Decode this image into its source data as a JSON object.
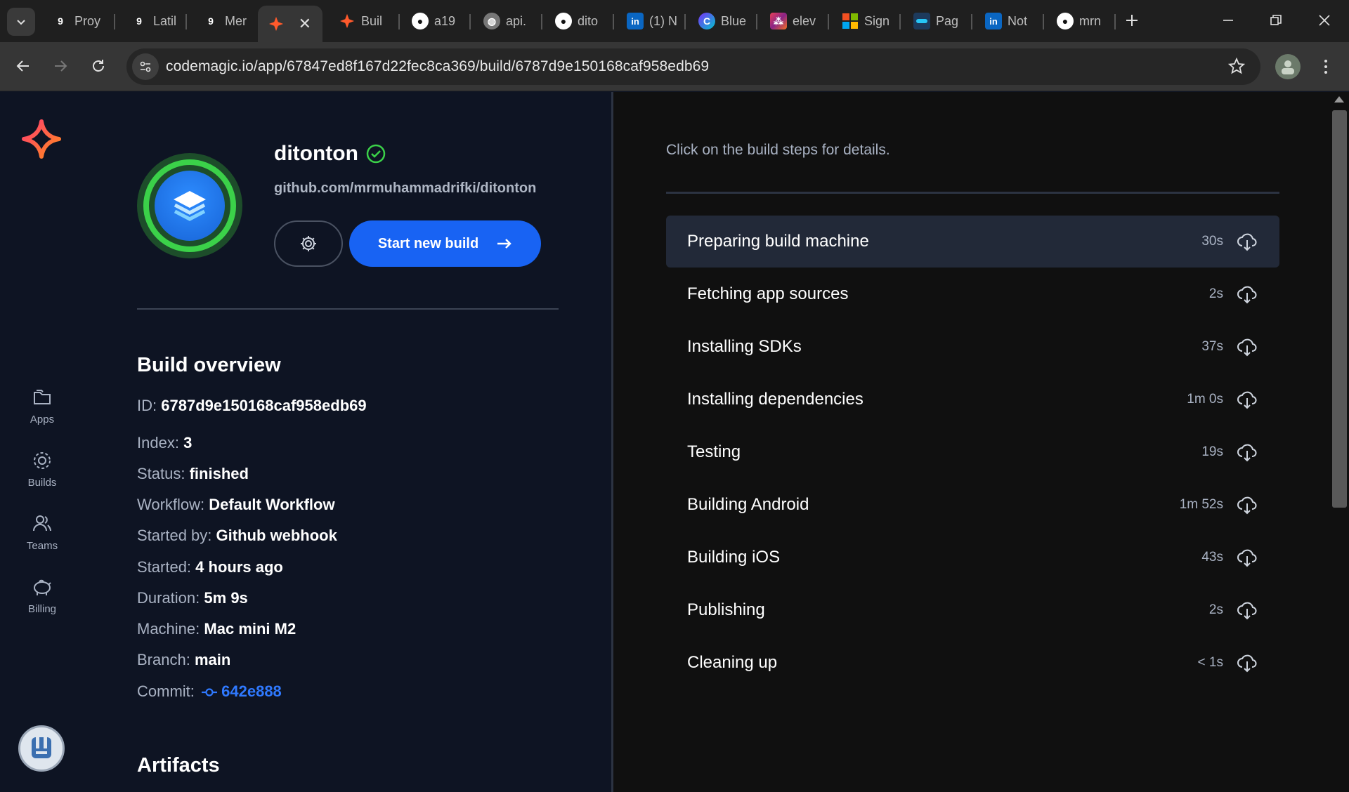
{
  "browser": {
    "tabs": [
      {
        "title": "Proy",
        "icon": "g9-icon"
      },
      {
        "title": "Latil",
        "icon": "g9-icon"
      },
      {
        "title": "Mer",
        "icon": "g9-icon"
      },
      {
        "title": "",
        "icon": "codemagic-icon"
      },
      {
        "title": "Buil",
        "icon": "codemagic-icon"
      },
      {
        "title": "a19",
        "icon": "github-icon"
      },
      {
        "title": "api.",
        "icon": "globe-icon"
      },
      {
        "title": "dito",
        "icon": "github-icon"
      },
      {
        "title": "(1) N",
        "icon": "linkedin-icon"
      },
      {
        "title": "Blue",
        "icon": "canva-icon"
      },
      {
        "title": "elev",
        "icon": "elevate-icon"
      },
      {
        "title": "Sign",
        "icon": "microsoft-icon"
      },
      {
        "title": "Pag",
        "icon": "page-icon"
      },
      {
        "title": "Not",
        "icon": "linkedin-icon"
      },
      {
        "title": "mrn",
        "icon": "github-icon"
      }
    ],
    "url": "codemagic.io/app/67847ed8f167d22fec8ca369/build/6787d9e150168caf958edb69"
  },
  "sidebar": {
    "items": [
      {
        "label": "Apps",
        "icon": "folder-icon"
      },
      {
        "label": "Builds",
        "icon": "builds-icon"
      },
      {
        "label": "Teams",
        "icon": "people-icon"
      },
      {
        "label": "Billing",
        "icon": "piggy-bank-icon"
      }
    ]
  },
  "app": {
    "name": "ditonton",
    "repo": "github.com/mrmuhammadrifki/ditonton",
    "start_build_label": "Start new build"
  },
  "overview": {
    "title": "Build overview",
    "id_label": "ID:",
    "id_value": "6787d9e150168caf958edb69",
    "index_label": "Index:",
    "index_value": "3",
    "status_label": "Status:",
    "status_value": "finished",
    "workflow_label": "Workflow:",
    "workflow_value": "Default Workflow",
    "started_by_label": "Started by:",
    "started_by_value": "Github webhook",
    "started_label": "Started:",
    "started_value": "4 hours ago",
    "duration_label": "Duration:",
    "duration_value": "5m 9s",
    "machine_label": "Machine:",
    "machine_value": "Mac mini M2",
    "branch_label": "Branch:",
    "branch_value": "main",
    "commit_label": "Commit:",
    "commit_value": "642e888"
  },
  "artifacts": {
    "title": "Artifacts"
  },
  "steps": {
    "hint": "Click on the build steps for details.",
    "items": [
      {
        "name": "Preparing build machine",
        "duration": "30s"
      },
      {
        "name": "Fetching app sources",
        "duration": "2s"
      },
      {
        "name": "Installing SDKs",
        "duration": "37s"
      },
      {
        "name": "Installing dependencies",
        "duration": "1m 0s"
      },
      {
        "name": "Testing",
        "duration": "19s"
      },
      {
        "name": "Building Android",
        "duration": "1m 52s"
      },
      {
        "name": "Building iOS",
        "duration": "43s"
      },
      {
        "name": "Publishing",
        "duration": "2s"
      },
      {
        "name": "Cleaning up",
        "duration": "< 1s"
      }
    ]
  },
  "colors": {
    "accent": "#1863f3",
    "success": "#3bd149",
    "commit_link": "#2f79ff"
  }
}
